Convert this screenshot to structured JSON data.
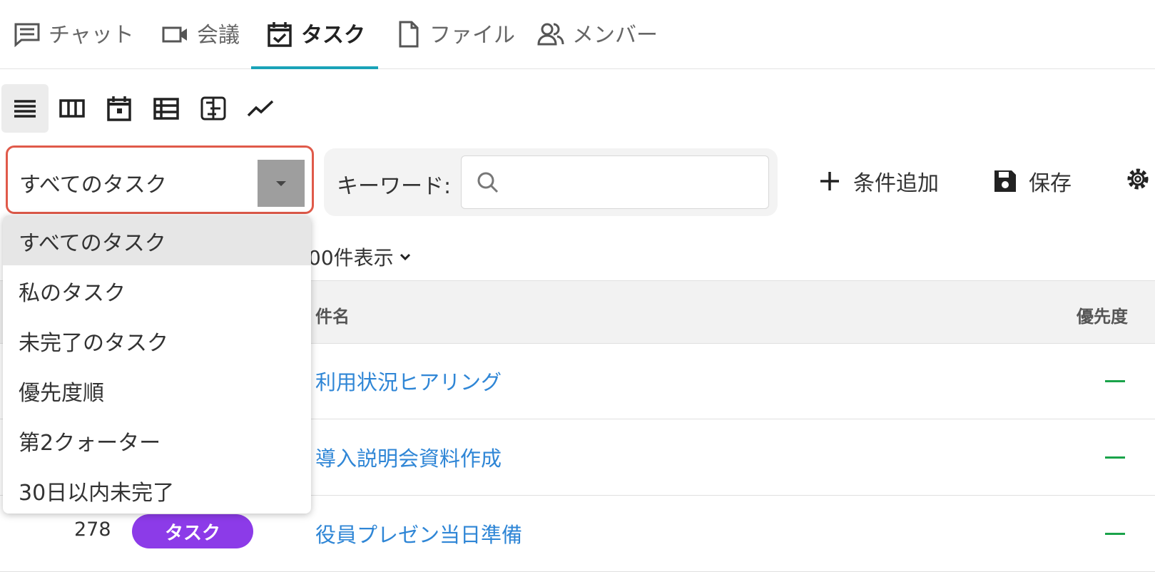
{
  "tabs": [
    {
      "label": "チャット",
      "icon": "chat-icon"
    },
    {
      "label": "会議",
      "icon": "video-icon"
    },
    {
      "label": "タスク",
      "icon": "calendar-check-icon",
      "active": true
    },
    {
      "label": "ファイル",
      "icon": "file-icon"
    },
    {
      "label": "メンバー",
      "icon": "members-icon"
    }
  ],
  "view_buttons": [
    "list-view-icon",
    "board-view-icon",
    "calendar-view-icon",
    "table-view-icon",
    "gantt-view-icon",
    "chart-view-icon"
  ],
  "filter": {
    "selected": "すべてのタスク",
    "options": [
      "すべてのタスク",
      "私のタスク",
      "未完了のタスク",
      "優先度順",
      "第2クォーター",
      "30日以内未完了"
    ]
  },
  "keyword": {
    "label": "キーワード:",
    "value": "",
    "placeholder": ""
  },
  "toolbar": {
    "add_condition": "条件追加",
    "save": "保存"
  },
  "count_label": "00件表示",
  "table": {
    "headers": {
      "name": "件名",
      "priority": "優先度"
    },
    "rows": [
      {
        "number": "",
        "type": "",
        "name": "利用状況ヒアリング",
        "priority": "—"
      },
      {
        "number": "",
        "type": "",
        "name": "導入説明会資料作成",
        "priority": "—"
      },
      {
        "number": "278",
        "type": "タスク",
        "name": "役員プレゼン当日準備",
        "priority": "—"
      }
    ]
  },
  "colors": {
    "accent": "#1aa3b8",
    "link": "#2f86d6",
    "badge": "#8c3be8",
    "priority": "#1aa34a",
    "highlight_border": "#e05a4a"
  }
}
